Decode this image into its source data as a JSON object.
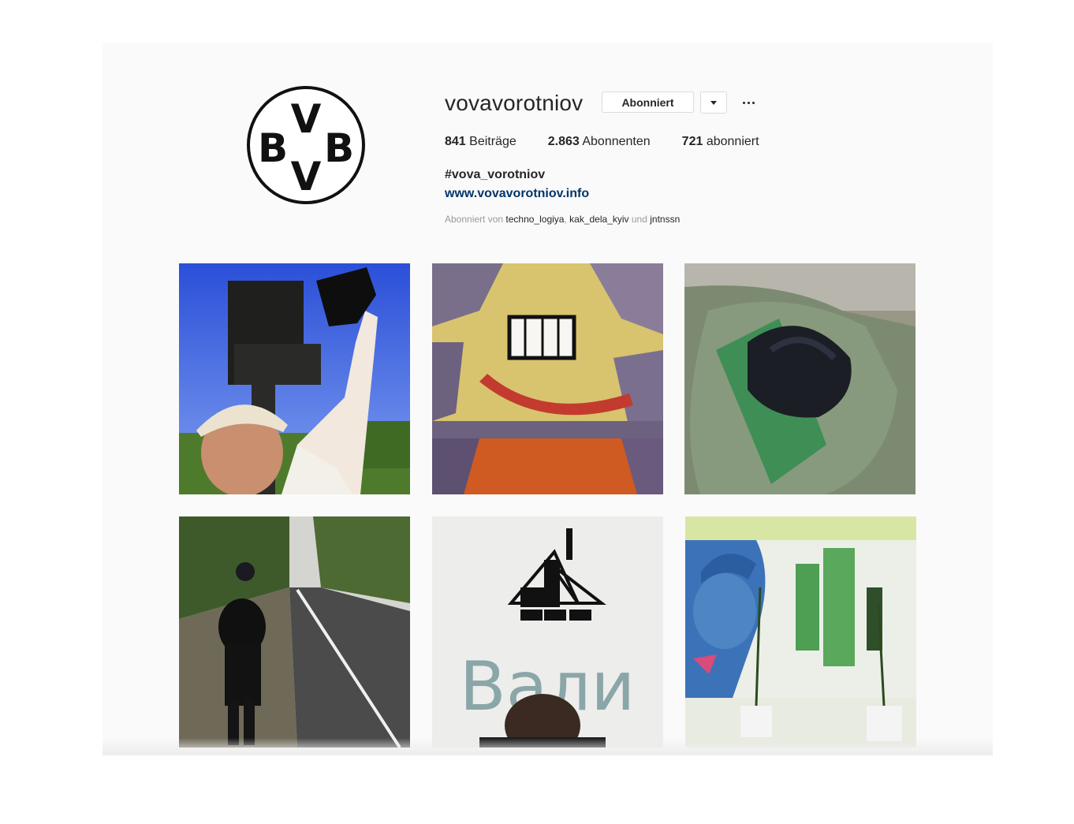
{
  "profile": {
    "username": "vovavorotniov",
    "follow_button": "Abonniert",
    "avatar_icon": "bvb-logo-icon",
    "dropdown_icon": "caret-down-icon",
    "more_icon": "ellipsis-icon"
  },
  "stats": {
    "posts_count": "841",
    "posts_label": "Beiträge",
    "followers_count": "2.863",
    "followers_label": "Abonnenten",
    "following_count": "721",
    "following_label": "abonniert"
  },
  "bio": {
    "name": "#vova_vorotniov",
    "link": "www.vovavorotniov.info"
  },
  "followed_by": {
    "prefix": "Abonniert von",
    "users": [
      "techno_logiya",
      "kak_dela_kyiv",
      "jntnssn"
    ],
    "separator": ",",
    "conjunction": "und"
  },
  "posts": [
    {
      "kind": "photo",
      "subject": "man-holding-coal-near-monument"
    },
    {
      "kind": "photo",
      "subject": "mosaic-face"
    },
    {
      "kind": "photo",
      "subject": "coal-on-green-shirt"
    },
    {
      "kind": "photo",
      "subject": "man-walking-road"
    },
    {
      "kind": "photo",
      "subject": "mine-logo-wall",
      "text": "Вали"
    },
    {
      "kind": "photo",
      "subject": "miner-mural-with-plants"
    }
  ],
  "colors": {
    "background": "#fafafa",
    "text": "#262626",
    "link": "#003569",
    "muted": "#999999",
    "border": "#dbdbdb"
  }
}
